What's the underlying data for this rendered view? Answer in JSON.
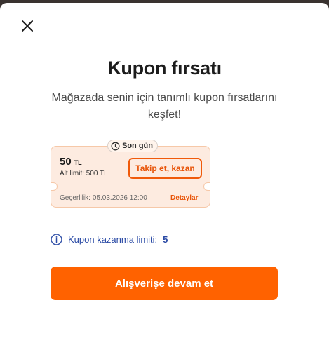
{
  "modal": {
    "close_icon": "close-icon",
    "title": "Kupon fırsatı",
    "subtitle": "Mağazada senin için tanımlı kupon fırsatlarını keşfet!"
  },
  "coupon": {
    "badge_icon": "clock-icon",
    "badge_label": "Son gün",
    "amount": "50",
    "currency": "TL",
    "lower_limit": "Alt limit: 500 TL",
    "follow_button": "Takip et, kazan",
    "validity_label": "Geçerlilik:",
    "validity_date": "05.03.2026 12:00",
    "details_link": "Detaylar"
  },
  "limit": {
    "icon": "info-icon",
    "label": "Kupon kazanma limiti:",
    "value": "5"
  },
  "continue_button": "Alışverişe devam et",
  "colors": {
    "accent": "#ff6200",
    "coupon_bg": "#fdebe0",
    "link_blue": "#2a4aa5"
  }
}
